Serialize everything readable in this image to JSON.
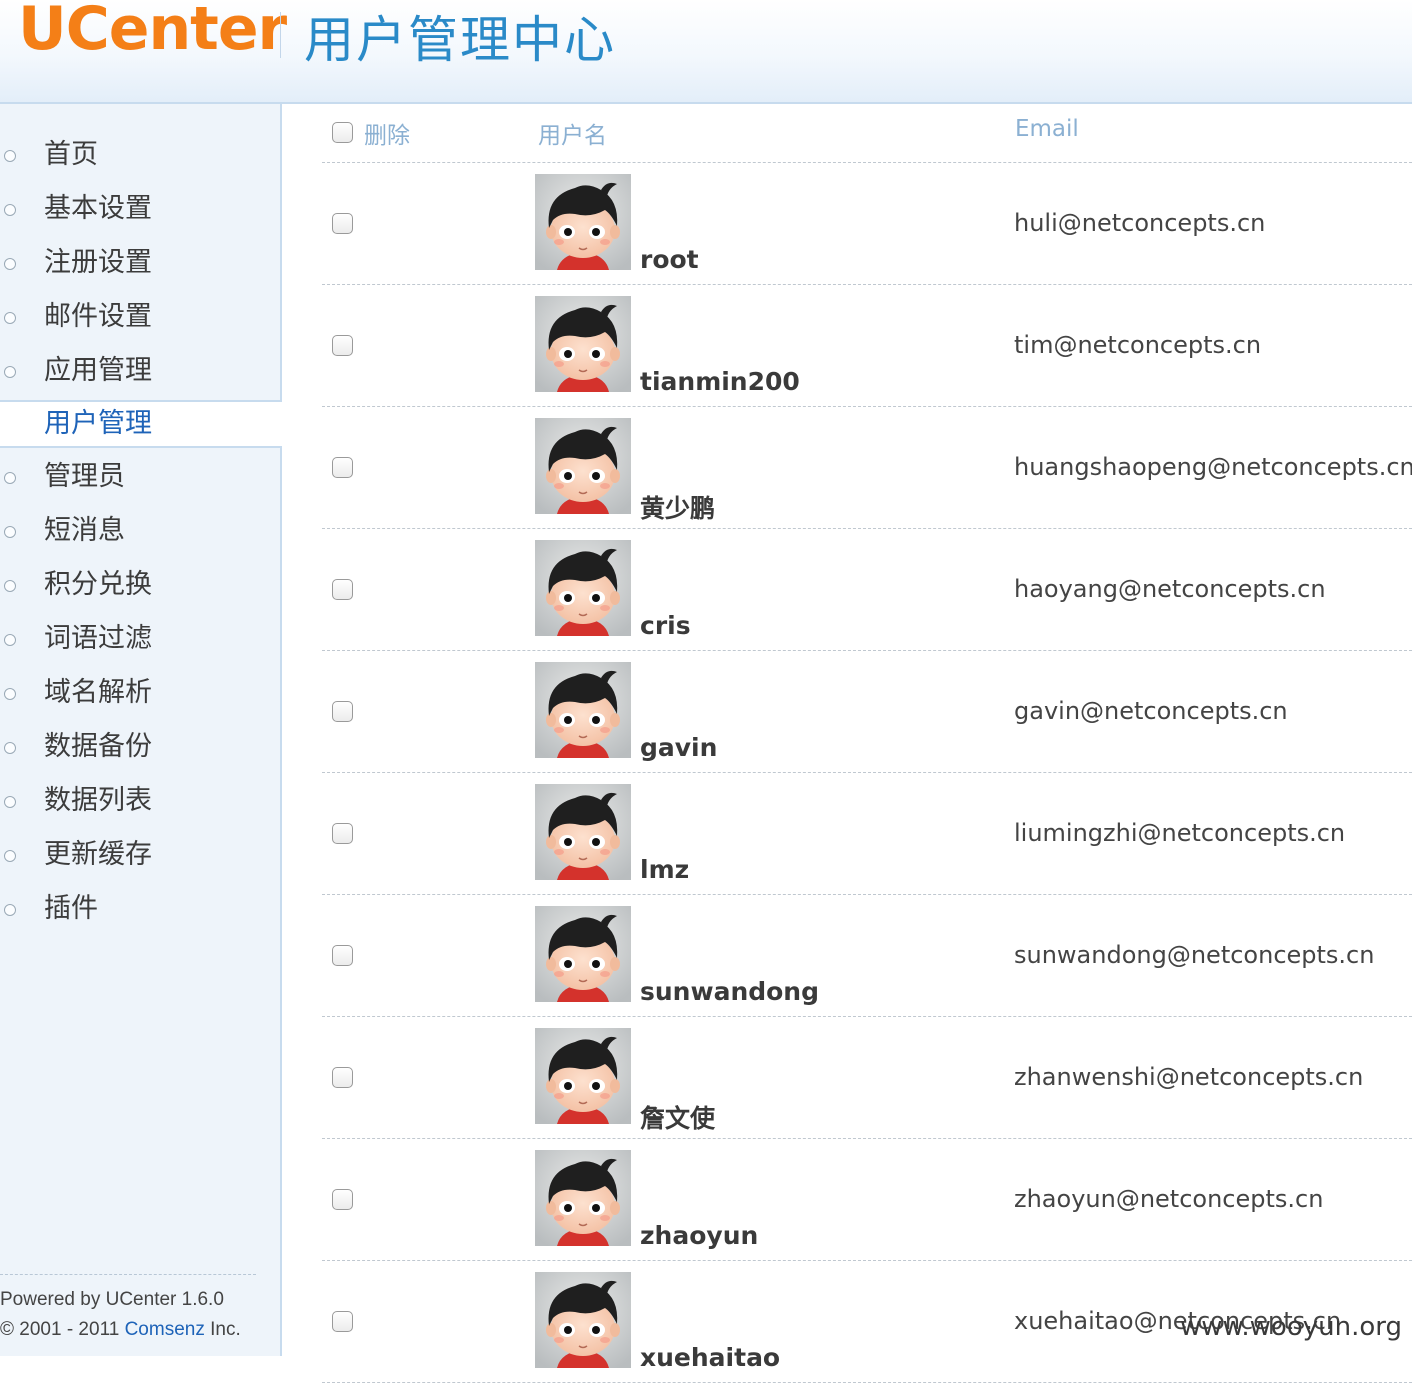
{
  "header": {
    "logo": "UCenter",
    "title": "用户管理中心"
  },
  "sidebar": {
    "items": [
      {
        "label": "首页"
      },
      {
        "label": "基本设置"
      },
      {
        "label": "注册设置"
      },
      {
        "label": "邮件设置"
      },
      {
        "label": "应用管理"
      },
      {
        "label": "用户管理",
        "active": true
      },
      {
        "label": "管理员"
      },
      {
        "label": "短消息"
      },
      {
        "label": "积分兑换"
      },
      {
        "label": "词语过滤"
      },
      {
        "label": "域名解析"
      },
      {
        "label": "数据备份"
      },
      {
        "label": "数据列表"
      },
      {
        "label": "更新缓存"
      },
      {
        "label": "插件"
      }
    ],
    "footer": {
      "powered": "Powered by UCenter 1.6.0",
      "copyright_prefix": "© 2001 - 2011 ",
      "company_link": "Comsenz",
      "copyright_suffix": " Inc."
    }
  },
  "table": {
    "headers": {
      "delete": "删除",
      "username": "用户名",
      "email": "Email"
    },
    "rows": [
      {
        "username": "root",
        "email": "huli@netconcepts.cn"
      },
      {
        "username": "tianmin200",
        "email": "tim@netconcepts.cn"
      },
      {
        "username": "黄少鹏",
        "email": "huangshaopeng@netconcepts.cn"
      },
      {
        "username": "cris",
        "email": "haoyang@netconcepts.cn"
      },
      {
        "username": "gavin",
        "email": "gavin@netconcepts.cn"
      },
      {
        "username": "lmz",
        "email": "liumingzhi@netconcepts.cn"
      },
      {
        "username": "sunwandong",
        "email": "sunwandong@netconcepts.cn"
      },
      {
        "username": "詹文使",
        "email": "zhanwenshi@netconcepts.cn"
      },
      {
        "username": "zhaoyun",
        "email": "zhaoyun@netconcepts.cn"
      },
      {
        "username": "xuehaitao",
        "email": "xuehaitao@netconcepts.cn"
      }
    ]
  },
  "watermark": "www.wooyun.org",
  "colors": {
    "logo": "#f47f17",
    "title": "#2a8ac8",
    "link": "#1e63b8",
    "header_text": "#8bb0d2"
  }
}
